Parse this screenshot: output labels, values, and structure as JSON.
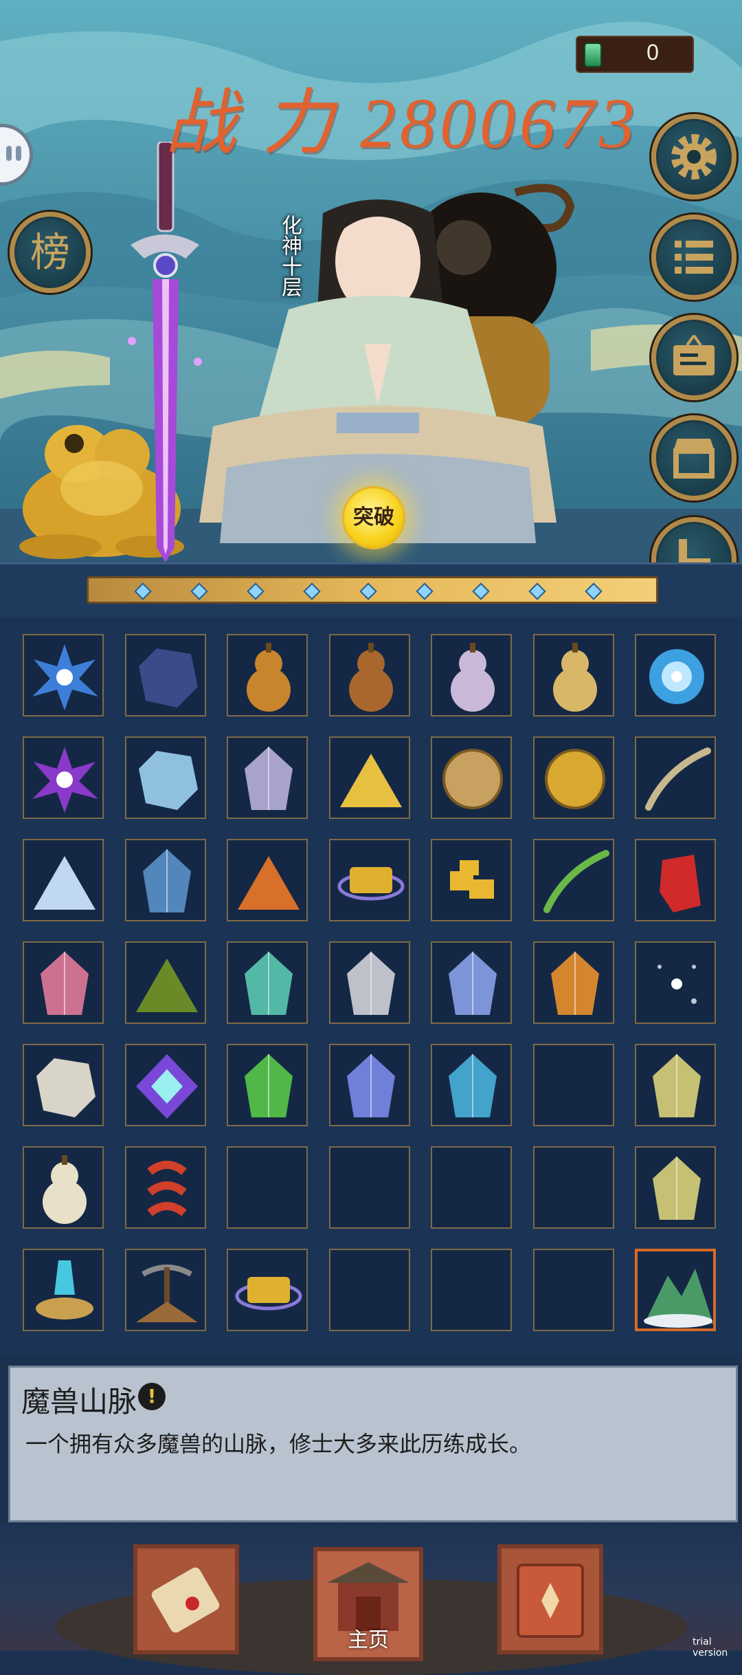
{
  "currency": {
    "icon": "jade-gem-icon",
    "value": "0"
  },
  "power": {
    "text": "战 力 2800673"
  },
  "character": {
    "realm": "化神十层"
  },
  "breakthrough": {
    "label": "突破"
  },
  "progress": {
    "nodes": 9
  },
  "side_buttons": [
    {
      "name": "settings-button",
      "icon": "gear-icon"
    },
    {
      "name": "menu-list-button",
      "icon": "list-icon"
    },
    {
      "name": "notice-board-button",
      "icon": "sign-board-icon"
    },
    {
      "name": "shop-button",
      "icon": "shop-icon"
    },
    {
      "name": "alchemy-button",
      "icon": "anvil-icon"
    }
  ],
  "rank_button": {
    "label": "榜"
  },
  "inventory": {
    "items": [
      {
        "icon": "blue-crystal-burst-icon",
        "color": "#3d7fd8"
      },
      {
        "icon": "dark-blue-ore-icon",
        "color": "#3b4a88"
      },
      {
        "icon": "gourd-icon",
        "color": "#c8852e"
      },
      {
        "icon": "carved-gourd-icon",
        "color": "#a9672e"
      },
      {
        "icon": "jade-gourd-icon",
        "color": "#c9b8d8"
      },
      {
        "icon": "golden-gourd-icon",
        "color": "#d8b868"
      },
      {
        "icon": "blue-vortex-icon",
        "color": "#3da0e0"
      },
      {
        "icon": "purple-crystal-burst-icon",
        "color": "#8a3ac8"
      },
      {
        "icon": "ice-ore-icon",
        "color": "#8fc0e0"
      },
      {
        "icon": "clear-crystal-icon",
        "color": "#b8b0d8"
      },
      {
        "icon": "golden-powder-pile-icon",
        "color": "#e8c040"
      },
      {
        "icon": "bronze-disc-icon",
        "color": "#c8a060"
      },
      {
        "icon": "cracked-gold-disc-icon",
        "color": "#d8a830"
      },
      {
        "icon": "spirit-wisp-icon",
        "color": "#c8b890"
      },
      {
        "icon": "white-powder-pile-icon",
        "color": "#c0d8f0"
      },
      {
        "icon": "blue-crystal-icon",
        "color": "#5a90c8"
      },
      {
        "icon": "orange-powder-pile-icon",
        "color": "#d8702a"
      },
      {
        "icon": "gold-ingot-ring-icon",
        "color": "#e0b030"
      },
      {
        "icon": "gold-nuggets-icon",
        "color": "#e8b830"
      },
      {
        "icon": "green-leaf-sliver-icon",
        "color": "#6ab848"
      },
      {
        "icon": "red-seal-icon",
        "color": "#d02a2a"
      },
      {
        "icon": "pink-crystal-icon",
        "color": "#e07a98"
      },
      {
        "icon": "green-powder-pile-icon",
        "color": "#6a8a28"
      },
      {
        "icon": "teal-spirit-stone-icon",
        "color": "#5ac8b0"
      },
      {
        "icon": "white-spirit-stone-icon",
        "color": "#d0d0d8"
      },
      {
        "icon": "blue-spirit-stone-icon",
        "color": "#8aa0e8"
      },
      {
        "icon": "orange-spirit-stone-icon",
        "color": "#e8902a"
      },
      {
        "icon": "star-dust-icon",
        "color": "#c0c8d8"
      },
      {
        "icon": "white-gold-ore-icon",
        "color": "#d8d4c8"
      },
      {
        "icon": "purple-gem-icon",
        "color": "#7a48d8"
      },
      {
        "icon": "green-spirit-stone-icon",
        "color": "#58c848"
      },
      {
        "icon": "indigo-spirit-stone-icon",
        "color": "#7a88e8"
      },
      {
        "icon": "cyan-spirit-stone-icon",
        "color": "#48b0d8"
      },
      {
        "icon": "",
        "color": ""
      },
      {
        "icon": "yellow-crystal-icon",
        "color": "#d8d078"
      },
      {
        "icon": "pearl-gourd-icon",
        "color": "#e8e0c8"
      },
      {
        "icon": "red-ribbon-icon",
        "color": "#d0402a"
      },
      {
        "icon": "",
        "color": ""
      },
      {
        "icon": "",
        "color": ""
      },
      {
        "icon": "",
        "color": ""
      },
      {
        "icon": "",
        "color": ""
      },
      {
        "icon": "yellow-crystal-icon",
        "color": "#d8d078"
      },
      {
        "icon": "crystal-fountain-icon",
        "color": "#48c8e0"
      },
      {
        "icon": "mining-pick-icon",
        "color": "#9a6a3a"
      },
      {
        "icon": "gold-ingot-ring-icon",
        "color": "#e0b030"
      },
      {
        "icon": "",
        "color": ""
      },
      {
        "icon": "",
        "color": ""
      },
      {
        "icon": "",
        "color": ""
      },
      {
        "icon": "monster-mountain-icon",
        "color": "#4a9a68"
      }
    ],
    "selected_index": 48
  },
  "description": {
    "title": "魔兽山脉",
    "text": "一个拥有众多魔兽的山脉，修士大多来此历练成长。"
  },
  "nav": {
    "items": [
      {
        "name": "scroll-tab",
        "icon": "scroll-icon",
        "label": ""
      },
      {
        "name": "home-tab",
        "icon": "temple-gate-icon",
        "label": "主页"
      },
      {
        "name": "book-tab",
        "icon": "spellbook-icon",
        "label": ""
      }
    ]
  },
  "watermark": "trial version"
}
